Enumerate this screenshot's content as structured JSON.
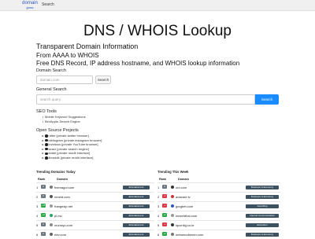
{
  "nav": {
    "logo_line1": "domain",
    "logo_line2": "glass",
    "search_link": "Search"
  },
  "header": {
    "title": "DNS / WHOIS Lookup",
    "subtitle1": "Transparent Domain Information",
    "subtitle2": "From AAAA to WHOIS",
    "subtitle3": "Free DNS Record, IP address hostname, and WHOIS lookup information"
  },
  "domain_search": {
    "label": "Domain Search",
    "placeholder": "domain.com",
    "button": "Search"
  },
  "general_search": {
    "label": "General Search",
    "placeholder": "search query",
    "button": "Search"
  },
  "seo_tools": {
    "title": "SEO Tools",
    "items": [
      "Mobile Keyword Suggestions",
      "Bin/Apple-Search Engine"
    ]
  },
  "open_source": {
    "title": "Open Source Projects",
    "items": [
      "nitter [private twitter browser]",
      "bibliogram [private instagram browser]",
      "invidious [private YouTube browser]",
      "searx [private search engine]",
      "teddit [private reddit interface]",
      "libreddit [private reddit interface]"
    ]
  },
  "trending_today": {
    "title": "Trending Domains Today",
    "col_rank": "Rank",
    "col_domain": "Domain",
    "rows": [
      {
        "rank": "1",
        "change": "0",
        "domain": "fnemagor.com",
        "category": "Entertainment"
      },
      {
        "rank": "2",
        "change": "0",
        "domain": "reneid.com",
        "category": "Entertainment"
      },
      {
        "rank": "3",
        "change": "+15",
        "domain": "frangesip.net",
        "category": "Entertainment"
      },
      {
        "rank": "4",
        "change": "+3",
        "domain": "pl.mo",
        "category": "Entertainment"
      },
      {
        "rank": "5",
        "change": "0",
        "domain": "murrayc.com",
        "category": "Entertainment"
      },
      {
        "rank": "6",
        "change": "0",
        "domain": "rtev.com",
        "category": "Entertainment"
      }
    ]
  },
  "trending_week": {
    "title": "Trending This Week",
    "col_rank": "Rank",
    "col_domain": "Domain",
    "rows": [
      {
        "rank": "1",
        "change": "0",
        "domain": "onl.com",
        "category": "Business & Economy"
      },
      {
        "rank": "2",
        "change": "-1",
        "domain": "aoseare.tv",
        "category": "Business & Economy"
      },
      {
        "rank": "3",
        "change": "-1",
        "domain": "gorgbet.com",
        "category": "Gambling"
      },
      {
        "rank": "4",
        "change": "+1",
        "domain": "mezetdhal.com",
        "category": "Internet Communication"
      },
      {
        "rank": "5",
        "change": "-1",
        "domain": "iqconfig.co.kr",
        "category": "Education"
      },
      {
        "rank": "6",
        "change": "+1",
        "domain": "metamodierner.com",
        "category": "Business & Economy"
      }
    ]
  },
  "colors": {
    "accent": "#1a8cff",
    "neutral_change": "#6c757d",
    "up_change": "#28a745",
    "down_change": "#dc3545",
    "category_badge": "#3d5261"
  }
}
